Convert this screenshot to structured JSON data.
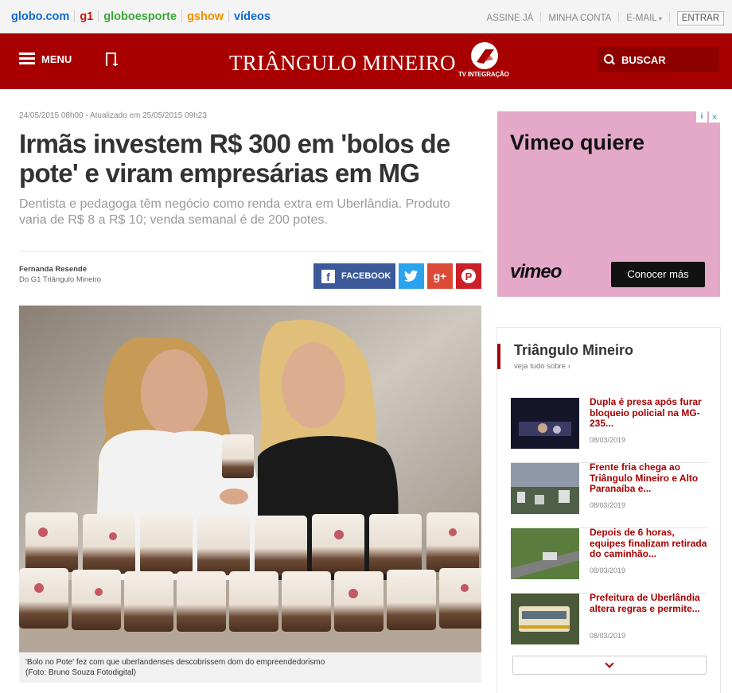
{
  "topbar": {
    "brands": [
      {
        "label": "globo.com",
        "color": "#0d6ad6"
      },
      {
        "label": "g1",
        "color": "#c4170c"
      },
      {
        "label": "globoesporte",
        "color": "#39a935"
      },
      {
        "label": "gshow",
        "color": "#f59000"
      },
      {
        "label": "vídeos",
        "color": "#0d6ad6"
      }
    ],
    "links": [
      "ASSINE JÁ",
      "MINHA CONTA",
      "E-MAIL"
    ],
    "entrar": "ENTRAR"
  },
  "header": {
    "menu_label": "MENU",
    "site_title": "TRIÂNGULO MINEIRO",
    "tv_logo_text": "TV INTEGRAÇÃO",
    "search_label": "BUSCAR",
    "accent_color": "#a80000"
  },
  "article": {
    "dateline": "24/05/2015 08h00 - Atualizado em 25/05/2015 09h23",
    "title": "Irmãs investem R$ 300 em 'bolos de pote' e viram empresárias em MG",
    "subtitle": "Dentista e pedagoga têm negócio como renda extra em Uberlândia. Produto varia de R$ 8 a R$ 10; venda semanal é de 200 potes.",
    "author": "Fernanda Resende",
    "affiliation": "Do G1 Triângulo Mineiro",
    "share": {
      "facebook": "FACEBOOK",
      "twitter_icon": "twitter-icon",
      "gplus": "g+",
      "pinterest": "P"
    },
    "caption_line1": "'Bolo no Pote' fez com que uberlandenses descobrissem dom do empreendedorismo",
    "caption_line2": "(Foto: Bruno Souza Fotodigital)"
  },
  "ad": {
    "title": "Vimeo quiere",
    "brand": "vimeo",
    "button": "Conocer más"
  },
  "sidebar": {
    "title": "Triângulo Mineiro",
    "more": "veja tudo sobre ›",
    "items": [
      {
        "headline": "Dupla é presa após furar bloqueio policial na MG-235...",
        "date": "08/03/2019"
      },
      {
        "headline": "Frente fria chega ao Triângulo Mineiro e Alto Paranaíba e...",
        "date": "08/03/2019"
      },
      {
        "headline": "Depois de 6 horas, equipes finalizam retirada do caminhão...",
        "date": "08/03/2019"
      },
      {
        "headline": "Prefeitura de Uberlândia altera regras e permite...",
        "date": "08/03/2019"
      }
    ]
  }
}
